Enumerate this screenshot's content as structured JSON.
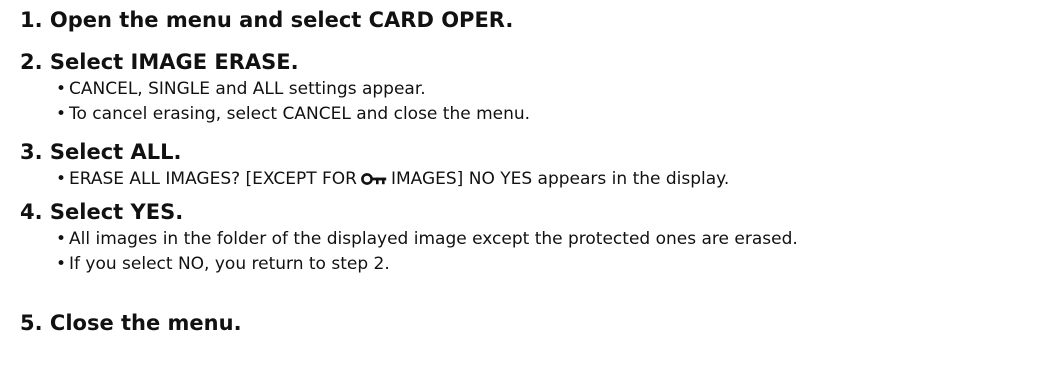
{
  "steps": [
    {
      "number": "1.",
      "title": "Open the menu and select CARD OPER.",
      "bullets": []
    },
    {
      "number": "2.",
      "title": "Select IMAGE ERASE.",
      "bullets": [
        "CANCEL, SINGLE and ALL settings appear.",
        "To cancel erasing, select CANCEL and close the menu."
      ]
    },
    {
      "number": "3.",
      "title": "Select ALL.",
      "bullets": [
        {
          "before": "ERASE ALL IMAGES? [EXCEPT FOR",
          "icon": "key-icon",
          "after": "IMAGES] NO YES appears in the display."
        }
      ]
    },
    {
      "number": "4.",
      "title": "Select YES.",
      "bullets": [
        "All images in the folder of the displayed image except the protected ones are erased.",
        "If you select NO, you return to step 2."
      ]
    },
    {
      "number": "5.",
      "title": "Close the menu.",
      "bullets": []
    }
  ],
  "bullet_glyph": "•"
}
